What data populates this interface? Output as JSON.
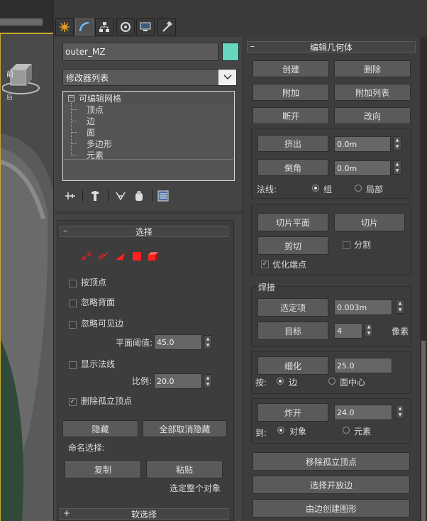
{
  "viewport": {
    "label": "前",
    "corner_text": "后"
  },
  "tabs": [
    "create-tab",
    "modify-tab",
    "hierarchy-tab",
    "motion-tab",
    "display-tab",
    "utilities-tab"
  ],
  "object": {
    "name": "outer_MZ",
    "color": "#66d6c0"
  },
  "modifier_list": {
    "value": "修改器列表"
  },
  "stack": {
    "root": "可编辑网格",
    "items": [
      "顶点",
      "边",
      "面",
      "多边形",
      "元素"
    ]
  },
  "selection": {
    "title": "选择",
    "by_vertex": "按顶点",
    "ignore_backface": "忽略背面",
    "ignore_visible_edges": "忽略可见边",
    "planar_threshold_label": "平面阈值:",
    "planar_threshold": "45.0",
    "show_normals": "显示法线",
    "scale_label": "比例:",
    "scale": "20.0",
    "delete_isolated": "删除孤立顶点",
    "hide": "隐藏",
    "unhide_all": "全部取消隐藏",
    "named_selection": "命名选择:",
    "copy": "复制",
    "paste": "粘贴",
    "select_whole": "选定整个对象"
  },
  "soft_selection": {
    "title": "软选择"
  },
  "edit_geometry": {
    "title": "编辑几何体",
    "create": "创建",
    "delete": "删除",
    "attach": "附加",
    "attach_list": "附加列表",
    "detach": "断开",
    "turn": "改向",
    "extrude": "挤出",
    "extrude_val": "0.0m",
    "chamfer": "倒角",
    "chamfer_val": "0.0m",
    "normals_label": "法线:",
    "normal_group": "组",
    "normal_local": "局部",
    "slice_plane": "切片平面",
    "slice": "切片",
    "cut": "剪切",
    "split": "分割",
    "refine_ends": "优化端点",
    "weld_title": "焊接",
    "selected": "选定项",
    "selected_val": "0.003m",
    "target": "目标",
    "target_val": "4",
    "pixels": "像素",
    "tessellate": "细化",
    "tessellate_val": "25.0",
    "by_label": "按:",
    "by_edge": "边",
    "by_face_center": "面中心",
    "explode": "炸开",
    "explode_val": "24.0",
    "to_label": "到:",
    "to_object": "对象",
    "to_element": "元素",
    "remove_isolated": "移除孤立顶点",
    "select_open_edges": "选择开放边",
    "create_shape": "由边创建图形"
  },
  "colors": {
    "accent_red": "#ff2020",
    "viewport_border": "#c7a82a"
  }
}
